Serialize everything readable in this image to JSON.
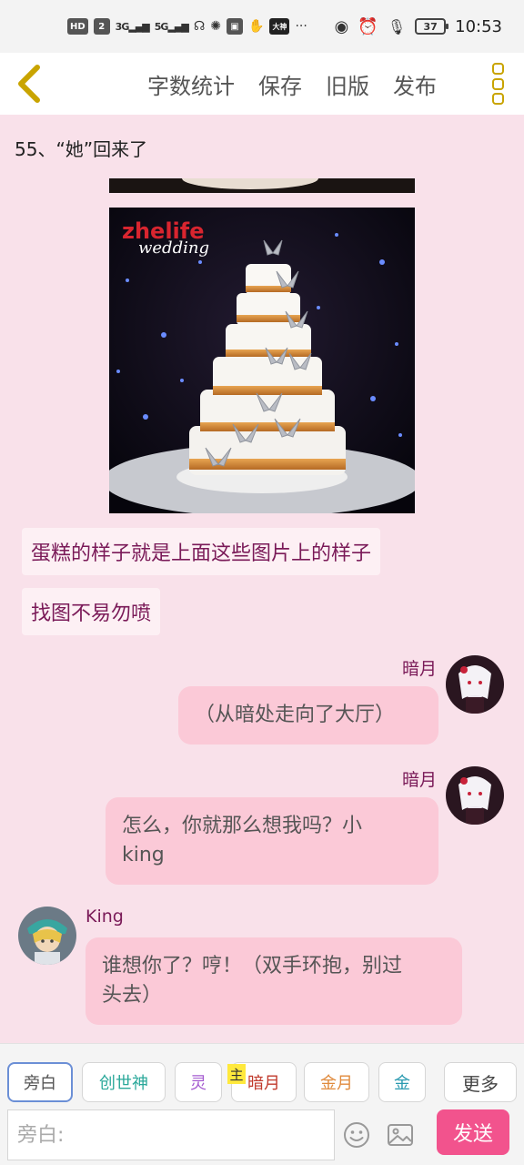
{
  "status_bar": {
    "left_chips": [
      "HD",
      "2"
    ],
    "signal_1": "3G",
    "signal_2": "5G",
    "app_badge": "大神",
    "more": "···",
    "battery": "37",
    "time": "10:53"
  },
  "toolbar": {
    "actions": [
      "字数统计",
      "保存",
      "旧版",
      "发布"
    ]
  },
  "content": {
    "chapter_title": "55、“她”回来了",
    "image_watermark_1": "zhelife",
    "image_watermark_2": "wedding",
    "narration_1": "蛋糕的样子就是上面这些图片上的样子",
    "narration_2": "找图不易勿喷",
    "messages": [
      {
        "speaker": "暗月",
        "side": "right",
        "text": "（从暗处走向了大厅）"
      },
      {
        "speaker": "暗月",
        "side": "right",
        "text_line1": "怎么，你就那么想我吗？小",
        "text_line2": "king"
      },
      {
        "speaker": "King",
        "side": "left",
        "text_line1": "谁想你了？哼！（双手环抱，别过",
        "text_line2": "头去）"
      }
    ]
  },
  "bottom": {
    "roles": [
      {
        "label": "旁白",
        "color": "#555555"
      },
      {
        "label": "创世神",
        "color": "#2aa89a"
      },
      {
        "label": "灵",
        "color": "#a45ad0"
      },
      {
        "label": "暗月",
        "color": "#c0392b"
      },
      {
        "label": "金月",
        "color": "#e08a3c"
      },
      {
        "label": "金",
        "color": "#2a9ab0"
      }
    ],
    "owner_tag": "主",
    "more_label": "更多",
    "input_placeholder": "旁白:",
    "send_label": "发送"
  },
  "colors": {
    "background": "#f9e1ea",
    "bubble": "#fbc9d7",
    "name": "#7a1a58",
    "send": "#f2538d",
    "menu_gold": "#c9a400"
  }
}
